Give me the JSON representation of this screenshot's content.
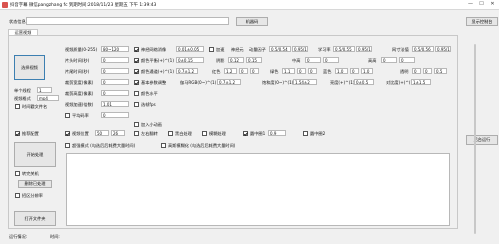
{
  "window": {
    "title": "抖音字幕  微信pangzhang fc  到期时间:2018/11/23 星期五 下午 1:39:43",
    "minimize": "—",
    "maximize": "☐",
    "close": "✕"
  },
  "top": {
    "status_label": "状态信息",
    "status_value": "",
    "machine_code_button": "机器码",
    "show_console_button": "显示控制台"
  },
  "tabs": [
    "运营视频"
  ],
  "left": {
    "select_video_button": "选择视频",
    "thread_label": "单个线程",
    "thread_value": "1",
    "video_format_label": "视频格式",
    "video_format_value": "mp4",
    "time_label_check": "时间戳文件名",
    "inference_check": "推荐配置",
    "start_button": "开始处理",
    "shutdown_check": "转完关机",
    "delete_button": "删除已处理",
    "detect_check": "招区分辨率",
    "open_folder_button": "打开文件夹"
  },
  "params": {
    "row1": {
      "video_quality_label": "视频质量(0-255)",
      "video_quality_value": "80~120",
      "dehash_label": "神经网络消像",
      "dehash_value": "0.01±0.05",
      "accelerate_label": "加速",
      "neural_label": "神经元",
      "momentum_label": "动量因子",
      "momentum_value": "0.5/0.54",
      "momentum_value2": "0.95/1",
      "learning_label": "学习率",
      "learning_value": "0.5/0.55",
      "learning_value2": "0.95/1",
      "network_label": "网寸法值",
      "network_value": "0.5/0.56",
      "network_value2": "0.95/1"
    },
    "row2": {
      "header_time_label": "片头时间(秒)",
      "header_time_value": "0",
      "color_balance_label": "颜色平衡(+)^(1)",
      "color_balance_value": "0±0.15",
      "shadow_label": "阴影",
      "shadow_value": "0.12",
      "shadow_value2": "0.15",
      "midtone_label": "中高",
      "midtone_value": "0",
      "midtone_value2": "0",
      "highlight_label": "高高",
      "highlight_value": "0",
      "highlight_value2": "0"
    },
    "row3": {
      "tail_time_label": "片尾时间(秒)",
      "tail_time_value": "0",
      "color_temp_label": "颜色通道(+)^(1)",
      "color_temp_value": "0.7±1.2",
      "red_label": "红色",
      "red_value": "1.2",
      "red_value2": "0",
      "red_value3": "0",
      "green_label": "绿色",
      "green_value": "1.1",
      "green_value2": "0",
      "green_value3": "0",
      "blue_label": "蓝色",
      "blue_value": "1.0",
      "blue_value2": "0",
      "blue_value3": "1.0",
      "alpha_label": "透明",
      "alpha_value": "0",
      "alpha_value2": "0",
      "alpha_value3": "0.5"
    },
    "row4": {
      "crop_width_label": "裁剪宽度(像素)",
      "crop_width_value": "0",
      "basic_image_label": "基本参数调整",
      "gamma_label": "伽马RGB(0~)^(1)",
      "gamma_value": "0.7±1.2",
      "saturation_label": "饱和度(0~)^(1)",
      "saturation_value": "1.54±2",
      "brightness_label": "亮度(+)^(1)",
      "brightness_value": "0±0.5",
      "contrast_label": "对比度(+)^(1)",
      "contrast_value": "1±1.5"
    },
    "row5": {
      "crop_height_label": "裁剪高度(像素)",
      "crop_height_value": "0",
      "color_level_label": "颜色水平"
    },
    "row6": {
      "speed_label": "视频加速(倍数)",
      "speed_value": "1.01",
      "fps_label": "选帧fps"
    },
    "row7": {
      "mirror_label": "平均码率",
      "mirror_value": "0"
    },
    "row8": {
      "add_subtitle_label": "加入小动画"
    },
    "row9": {
      "video_size_label": "视频位置",
      "video_size_value1": "50",
      "video_size_value2": "26",
      "lr_flip_label": "左右翻转",
      "bw_label": "黑白处理",
      "blur_label": "模糊处理",
      "circle1_label": "圆中圈1",
      "circle1_value": "0.9",
      "circle2_label": "圆中圈2"
    },
    "row10": {
      "super_label": "超强模式 (勾选后后耗费大量时间)",
      "hd_label": "高斯模糊化 (勾选后后耗费大量时间)"
    }
  },
  "right": {
    "background_run_button": "后台运行"
  },
  "bottom": {
    "status_label": "运行情况:",
    "time_label": "时间:"
  }
}
